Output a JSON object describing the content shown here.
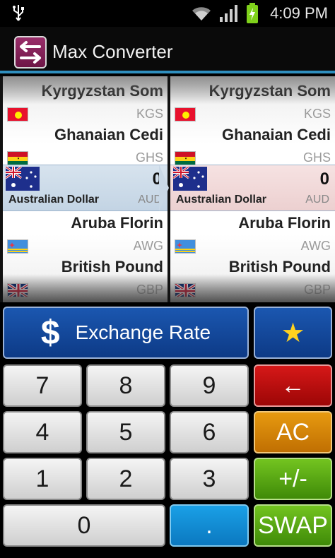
{
  "status_bar": {
    "time": "4:09 PM",
    "usb_icon": "usb-icon",
    "wifi_icon": "wifi-icon",
    "signal_icon": "signal-icon",
    "battery_icon": "battery-charging-icon"
  },
  "title_bar": {
    "title": "Max Converter",
    "app_icon": "swap-arrows-icon"
  },
  "from_currency": {
    "above": [
      {
        "name": "Kyrgyzstan Som",
        "code": "KGS"
      },
      {
        "name": "Ghanaian Cedi",
        "code": "GHS"
      }
    ],
    "selected": {
      "name": "Australian Dollar",
      "code": "AUD",
      "value": "0"
    },
    "below": [
      {
        "name": "Aruba Florin",
        "code": "AWG"
      },
      {
        "name": "British Pound",
        "code": "GBP"
      }
    ]
  },
  "to_currency": {
    "above": [
      {
        "name": "Kyrgyzstan Som",
        "code": "KGS"
      },
      {
        "name": "Ghanaian Cedi",
        "code": "GHS"
      }
    ],
    "selected": {
      "name": "Australian Dollar",
      "code": "AUD",
      "value": "0"
    },
    "below": [
      {
        "name": "Aruba Florin",
        "code": "AWG"
      },
      {
        "name": "British Pound",
        "code": "GBP"
      }
    ]
  },
  "keypad": {
    "exchange_rate_label": "Exchange Rate",
    "dollar_symbol": "$",
    "favorite_icon": "star-icon",
    "keys": {
      "seven": "7",
      "eight": "8",
      "nine": "9",
      "four": "4",
      "five": "5",
      "six": "6",
      "one": "1",
      "two": "2",
      "three": "3",
      "zero": "0",
      "dot": ".",
      "backspace": "←",
      "clear": "AC",
      "sign": "+/-",
      "swap": "SWAP"
    }
  },
  "colors": {
    "accent_line": "#2f8fbf",
    "exchange_blue": "#1b57b0",
    "backspace_red": "#d61818",
    "clear_orange": "#e79a10",
    "sign_green": "#73c420",
    "dot_blue": "#1aa0e6",
    "star_yellow": "#ffd21f"
  }
}
